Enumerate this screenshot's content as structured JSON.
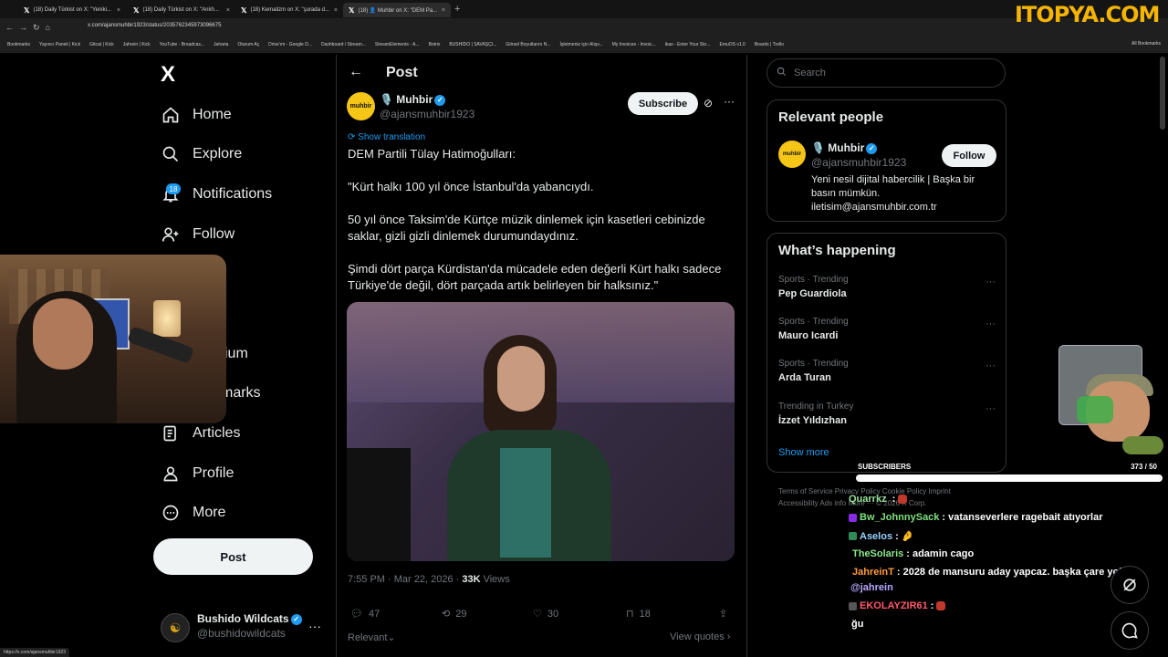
{
  "browser": {
    "tabs": [
      {
        "label": "(18) Daily Türkist on X: \"Yeniki..."
      },
      {
        "label": "(18) Daily Türkist on X: \"Ankh..."
      },
      {
        "label": "(18) Kemalizm on X: \"şurada d..."
      },
      {
        "label": "(18) 👤 Muhbir on X: \"DEM Pa..."
      }
    ],
    "brand_overlay": "ITOPYA.COM",
    "url": "x.com/ajansmuhbir1923/status/2035762345973096675",
    "bookmarks": [
      "Bookmarks",
      "Yayıncı Paneli | Kick",
      "Gitcat | Kick",
      "Jahrein | Kick",
      "YouTube - Broadcas...",
      "Jaharia",
      "Oturum Aç",
      "Drive'ım - Google D...",
      "Dashboard / Stream...",
      "StreamElements - A...",
      "Botrix",
      "BUSHIDO | SAVAŞÇI...",
      "Görsel Boyutlarını N...",
      "İşletmeniz için Alışv...",
      "My Invoices - Invoic...",
      "ikas - Enter Your Sto...",
      "EmuOS v1.0",
      "Boards | Trello"
    ],
    "all_bookmarks": "All Bookmarks",
    "status_url": "https://x.com/ajansmuhbir1923"
  },
  "nav": {
    "logo": "X",
    "items": [
      {
        "label": "Home"
      },
      {
        "label": "Explore"
      },
      {
        "label": "Notifications",
        "badge": "18"
      },
      {
        "label": "Follow"
      },
      {
        "label": "ium"
      },
      {
        "label": "marks"
      },
      {
        "label": "Articles"
      },
      {
        "label": "Profile"
      },
      {
        "label": "More"
      }
    ],
    "post_button": "Post",
    "account": {
      "name": "Bushido Wildcats",
      "handle": "@bushidowildcats"
    }
  },
  "post": {
    "header_title": "Post",
    "author": {
      "avatar_text": "muhbir",
      "name": "🎙️ Muhbir",
      "handle": "@ajansmuhbir1923"
    },
    "subscribe": "Subscribe",
    "show_translation": "Show translation",
    "paragraphs": [
      "DEM Partili Tülay Hatimoğulları:",
      "\"Kürt halkı 100 yıl önce İstanbul'da yabancıydı.",
      "50 yıl önce Taksim'de Kürtçe müzik dinlemek için kasetleri cebinizde saklar, gizli gizli dinlemek durumundaydınız.",
      "Şimdi dört parça Kürdistan'da mücadele eden değerli Kürt halkı sadece Türkiye'de değil, dört parçada artık belirleyen bir halksınız.\""
    ],
    "time": "7:55 PM · Mar 22, 2026 · ",
    "views_count": "33K",
    "views_label": " Views",
    "actions": {
      "replies": "47",
      "reposts": "29",
      "likes": "30",
      "bookmarks": "18"
    },
    "relevant": "Relevant",
    "view_quotes": "View quotes"
  },
  "right": {
    "search_placeholder": "Search",
    "relevant_people": {
      "title": "Relevant people",
      "name": "🎙️ Muhbir",
      "handle": "@ajansmuhbir1923",
      "follow": "Follow",
      "bio": "Yeni nesil dijital habercilik | Başka bir basın mümkün. iletisim@ajansmuhbir.com.tr"
    },
    "happening": {
      "title": "What’s happening",
      "trends": [
        {
          "context": "Sports · Trending",
          "topic": "Pep Guardiola"
        },
        {
          "context": "Sports · Trending",
          "topic": "Mauro Icardi"
        },
        {
          "context": "Sports · Trending",
          "topic": "Arda Turan"
        },
        {
          "context": "Trending in Turkey",
          "topic": "İzzet Yıldızhan"
        }
      ],
      "show_more": "Show more"
    },
    "footer": "Terms of Service   Privacy Policy   Cookie Policy   Imprint   Accessibility   Ads info   More ···   © 2026 X Corp."
  },
  "overlay": {
    "subscribers_label": "SUBSCRIBERS",
    "subscribers_count": "373  / 50",
    "subscribers_fraction": 1.0,
    "chat": [
      {
        "user": "Quarrkz",
        "text": "",
        "color": "#9be39b"
      },
      {
        "user": "Bw_JohnnySack",
        "text": " : vatanseverlere ragebait atıyorlar",
        "color": "#7fe07f"
      },
      {
        "user": "Aselos",
        "text": " : ",
        "color": "#9ad3ff"
      },
      {
        "user": "TheSolaris",
        "text": " : adamin cago",
        "color": "#8be88b"
      },
      {
        "user": "JahreinT",
        "text": " : 2028 de mansuru aday yapcaz. başka çare yok",
        "color": "#ff9a3c"
      },
      {
        "user": "@jahrein",
        "text": "",
        "color": "#b9a8ff"
      },
      {
        "user": "EKOLAYZIR61",
        "text": " : ",
        "color": "#ff5a6a"
      },
      {
        "user": "",
        "text": "ğu",
        "color": "#ffffff"
      }
    ]
  }
}
